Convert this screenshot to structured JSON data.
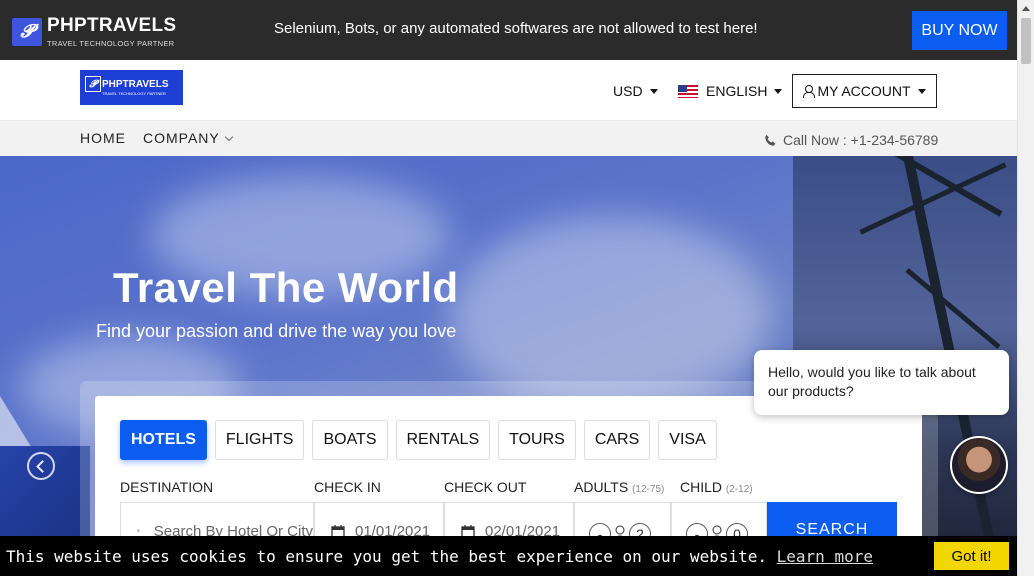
{
  "topbar": {
    "logo_title": "PHPTRAVELS",
    "logo_tagline": "TRAVEL TECHNOLOGY PARTNER",
    "notice": "Selenium, Bots, or any automated softwares are not allowed to test here!",
    "buy_now": "BUY NOW"
  },
  "header": {
    "logo_title": "PHPTRAVELS",
    "logo_tagline": "TRAVEL TECHNOLOGY PARTNER",
    "currency": "USD",
    "language": "ENGLISH",
    "account": "MY ACCOUNT"
  },
  "nav": {
    "home": "HOME",
    "company": "COMPANY",
    "call_now": "Call Now : +1-234-56789"
  },
  "hero": {
    "title": "Travel The World",
    "subtitle": "Find your passion and drive the way you love"
  },
  "search": {
    "tabs": [
      "HOTELS",
      "FLIGHTS",
      "BOATS",
      "RENTALS",
      "TOURS",
      "CARS",
      "VISA"
    ],
    "active_tab": "HOTELS",
    "destination_label": "DESTINATION",
    "destination_placeholder": "Search By Hotel Or City",
    "checkin_label": "CHECK IN",
    "checkin_value": "01/01/2021",
    "checkout_label": "CHECK OUT",
    "checkout_value": "02/01/2021",
    "adults_label": "ADULTS",
    "adults_range": "(12-75)",
    "adults_value": "2",
    "child_label": "CHILD",
    "child_range": "(2-12)",
    "child_value": "0",
    "search_button": "SEARCH"
  },
  "chat": {
    "message": "Hello, would you like to talk about our products?"
  },
  "cookie": {
    "text": "This website uses cookies to ensure you get the best experience on our website.",
    "link": "Learn more",
    "button": "Got it!"
  },
  "colors": {
    "accent": "#0b5cf0",
    "topbar_bg": "#2b2b2b",
    "cookie_button": "#f1d600"
  }
}
